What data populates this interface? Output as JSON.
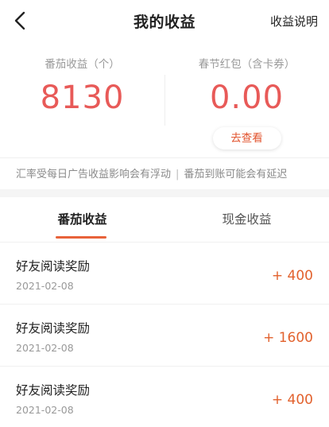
{
  "header": {
    "title": "我的收益",
    "help_link": "收益说明",
    "back_icon": "chevron-left-icon"
  },
  "summary": {
    "tomato": {
      "label": "番茄收益（个）",
      "value": "8130"
    },
    "red_packet": {
      "label": "春节红包（含卡券）",
      "value": "0.00",
      "button": "去查看"
    }
  },
  "notice": {
    "part1": "汇率受每日广告收益影响会有浮动",
    "separator": "|",
    "part2": "番茄到账可能会有延迟"
  },
  "tabs": [
    {
      "label": "番茄收益",
      "active": true
    },
    {
      "label": "现金收益",
      "active": false
    }
  ],
  "records": [
    {
      "title": "好友阅读奖励",
      "date": "2021-02-08",
      "amount": "+ 400"
    },
    {
      "title": "好友阅读奖励",
      "date": "2021-02-08",
      "amount": "+ 1600"
    },
    {
      "title": "好友阅读奖励",
      "date": "2021-02-08",
      "amount": "+ 400"
    }
  ],
  "colors": {
    "accent_red": "#e85a58",
    "accent_orange": "#e2622e"
  }
}
